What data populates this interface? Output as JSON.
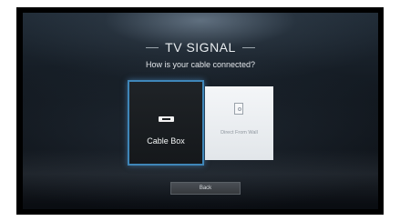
{
  "screen": {
    "title": "TV SIGNAL",
    "question": "How is your cable connected?"
  },
  "options": [
    {
      "label": "Cable Box",
      "icon": "cable-box-icon",
      "selected": true
    },
    {
      "label": "Direct From Wall",
      "icon": "wall-outlet-icon",
      "selected": false
    }
  ],
  "actions": {
    "back_label": "Back"
  },
  "colors": {
    "selection_outline": "#3f86b8",
    "background_dark": "#0a0d12"
  }
}
